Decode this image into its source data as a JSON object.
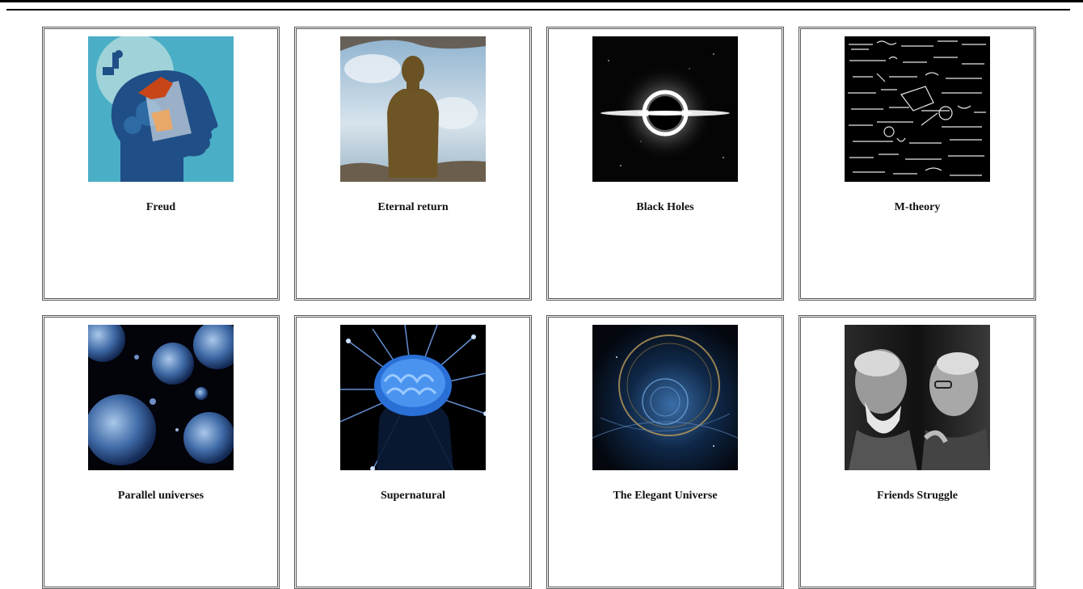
{
  "cards": [
    {
      "title": "Freud",
      "image_desc": "head-silhouette-gears-icon"
    },
    {
      "title": "Eternal return",
      "image_desc": "reflection-silhouette-icon"
    },
    {
      "title": "Black Holes",
      "image_desc": "black-hole-icon"
    },
    {
      "title": "M-theory",
      "image_desc": "equations-chalkboard-icon"
    },
    {
      "title": "Parallel universes",
      "image_desc": "bubble-universes-icon"
    },
    {
      "title": "Supernatural",
      "image_desc": "glowing-brain-icon"
    },
    {
      "title": "The Elegant Universe",
      "image_desc": "cosmic-rings-icon"
    },
    {
      "title": "Friends Struggle",
      "image_desc": "two-men-portrait-icon"
    }
  ]
}
